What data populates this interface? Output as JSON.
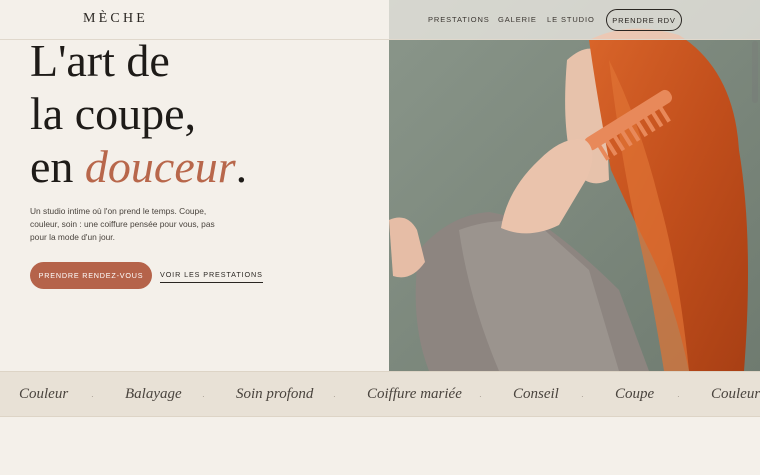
{
  "brand": {
    "logo": "MÈCHE"
  },
  "nav": {
    "items": [
      {
        "label": "PRESTATIONS"
      },
      {
        "label": "GALERIE"
      },
      {
        "label": "LE STUDIO"
      }
    ],
    "cta_label": "PRENDRE RDV"
  },
  "hero": {
    "title_line1": "L'art de",
    "title_line2": "la coupe,",
    "title_line3_prefix": "en ",
    "title_line3_accent": "douceur",
    "title_line3_suffix": ".",
    "description": "Un studio intime où l'on prend le temps. Coupe, couleur, soin : une coiffure pensée pour vous, pas pour la mode d'un jour.",
    "primary_button": "PRENDRE RENDEZ-VOUS",
    "secondary_link": "VOIR LES PRESTATIONS",
    "image_icon": "woman-combing-red-hair-photo"
  },
  "marquee": {
    "items": [
      "Couleur",
      "Balayage",
      "Soin profond",
      "Coiffure mariée",
      "Conseil",
      "Coupe",
      "Couleur"
    ],
    "separator": "·"
  },
  "colors": {
    "background": "#f4f0ea",
    "accent": "#b5634a",
    "band": "#e8e1d6"
  }
}
